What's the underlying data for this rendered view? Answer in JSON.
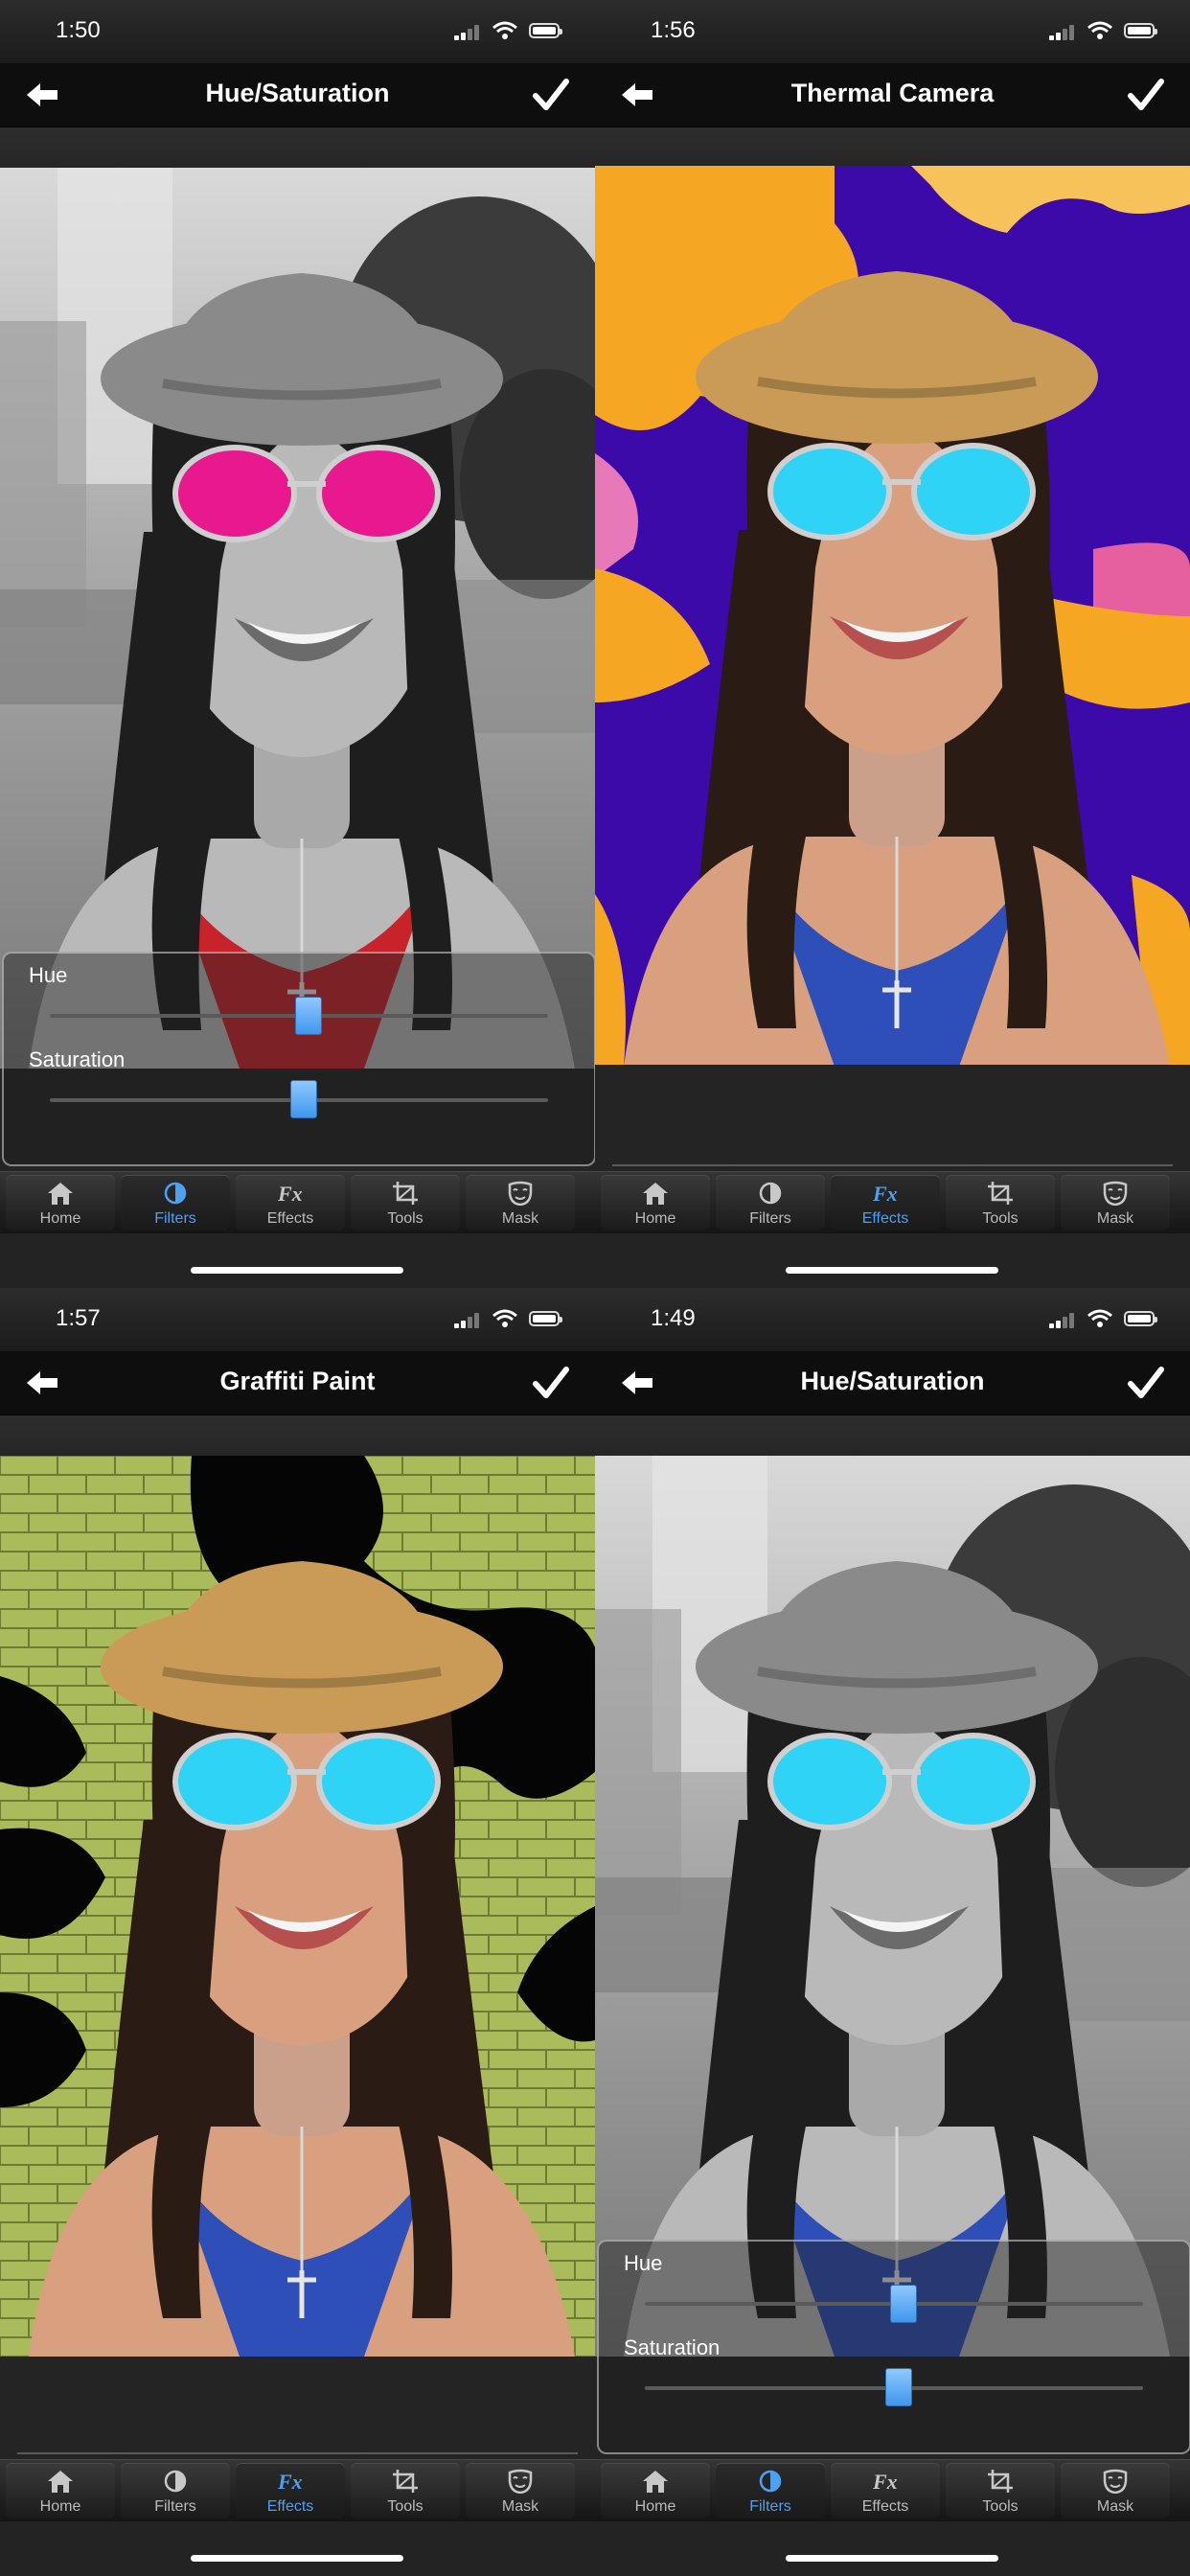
{
  "tabs": [
    "Home",
    "Filters",
    "Effects",
    "Tools",
    "Mask"
  ],
  "controls": {
    "hue_label": "Hue",
    "saturation_label": "Saturation"
  },
  "panels": [
    {
      "time": "1:50",
      "title": "Hue/Saturation",
      "active_tab": 1,
      "effect": "hue-saturation-pink",
      "hue_value": 0.52,
      "saturation_value": 0.51
    },
    {
      "time": "1:56",
      "title": "Thermal Camera",
      "active_tab": 2,
      "effect": "thermal-camera"
    },
    {
      "time": "1:57",
      "title": "Graffiti Paint",
      "active_tab": 2,
      "effect": "graffiti-paint"
    },
    {
      "time": "1:49",
      "title": "Hue/Saturation",
      "active_tab": 1,
      "effect": "hue-saturation-cyan",
      "hue_value": 0.52,
      "saturation_value": 0.51
    }
  ],
  "colors": {
    "accent": "#4ea0f2",
    "thermal_purple": "#3c0aa8",
    "thermal_orange": "#f5a623",
    "graffiti_green": "#a9bb5a",
    "lens_pink": "#e8188f",
    "lens_cyan": "#2fd3f5",
    "top_red": "#c8232b",
    "top_blue": "#2f4fb8"
  },
  "icons": [
    "back-arrow-icon",
    "checkmark-icon",
    "signal-icon",
    "wifi-icon",
    "battery-icon",
    "home-icon",
    "filters-icon",
    "effects-icon",
    "tools-icon",
    "mask-icon"
  ]
}
